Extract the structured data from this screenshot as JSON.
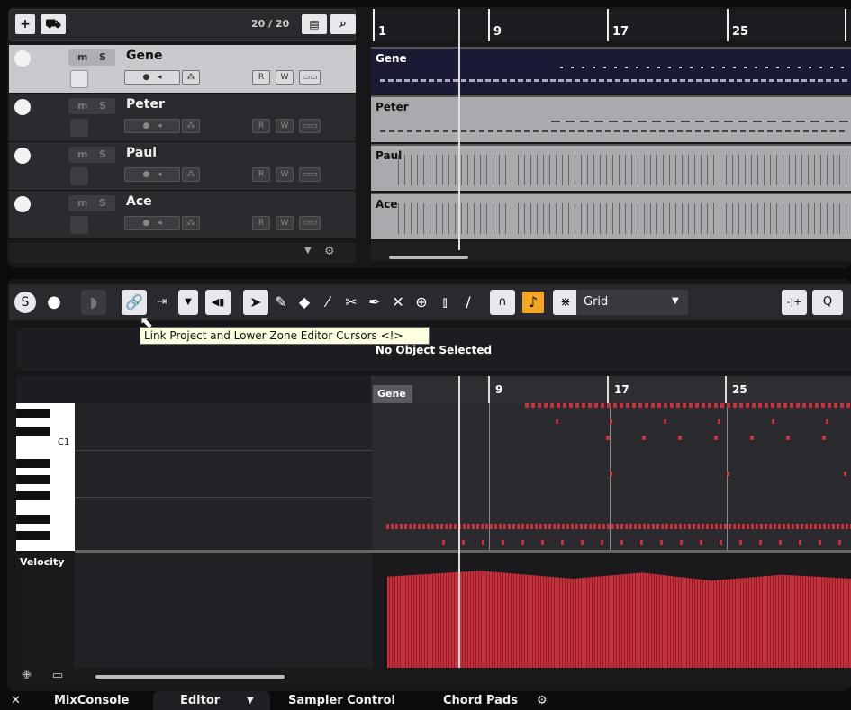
{
  "track_list": {
    "count": "20 / 20",
    "add_icon": "plus-icon",
    "folder_icon": "add-folder-icon"
  },
  "tracks": [
    {
      "name": "Gene",
      "selected": true,
      "mute": "m",
      "solo": "S",
      "read": "R",
      "write": "W"
    },
    {
      "name": "Peter",
      "selected": false,
      "mute": "m",
      "solo": "S",
      "read": "R",
      "write": "W"
    },
    {
      "name": "Paul",
      "selected": false,
      "mute": "m",
      "solo": "S",
      "read": "R",
      "write": "W"
    },
    {
      "name": "Ace",
      "selected": false,
      "mute": "m",
      "solo": "S",
      "read": "R",
      "write": "W"
    }
  ],
  "ruler": {
    "bars": [
      "1",
      "9",
      "17",
      "25"
    ]
  },
  "lanes": [
    "Gene",
    "Peter",
    "Paul",
    "Ace"
  ],
  "editor": {
    "tooltip": "Link Project and Lower Zone Editor Cursors <!>",
    "info": "No Object Selected",
    "quantize": "Grid",
    "part_name": "Gene",
    "pr_bars": [
      "9",
      "17",
      "25"
    ],
    "key_label": "C1",
    "velocity_label": "Velocity",
    "accent_color": "#f5a623",
    "note_color": "#c8303c"
  },
  "tabs": {
    "close": "✕",
    "mixconsole": "MixConsole",
    "editor": "Editor",
    "sampler": "Sampler Control",
    "chordpads": "Chord Pads"
  }
}
